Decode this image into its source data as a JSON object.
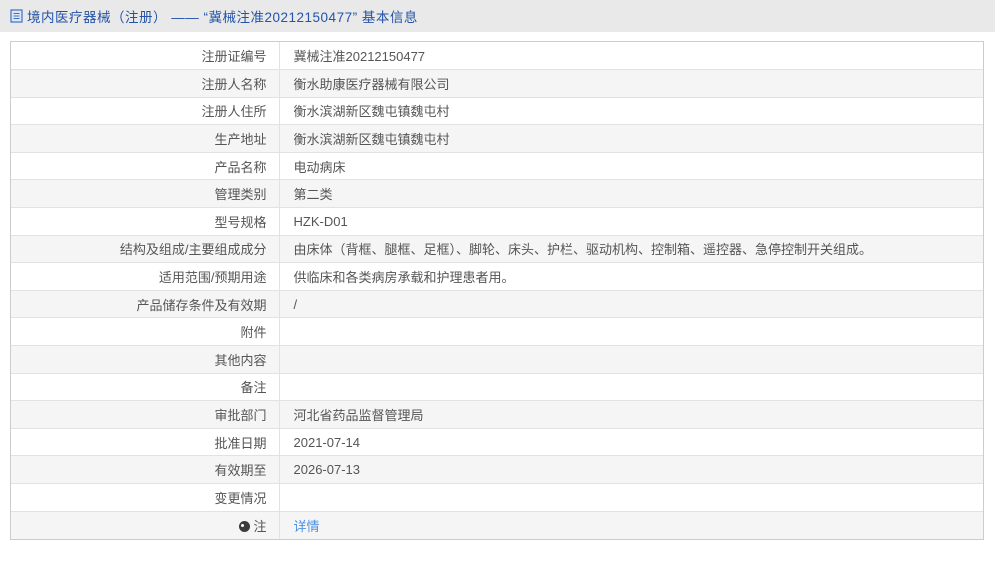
{
  "header": {
    "title": "境内医疗器械（注册） —— “冀械注准20212150477” 基本信息"
  },
  "table": {
    "rows": [
      {
        "label": "注册证编号",
        "value": "冀械注准20212150477"
      },
      {
        "label": "注册人名称",
        "value": "衡水助康医疗器械有限公司"
      },
      {
        "label": "注册人住所",
        "value": "衡水滨湖新区魏屯镇魏屯村"
      },
      {
        "label": "生产地址",
        "value": "衡水滨湖新区魏屯镇魏屯村"
      },
      {
        "label": "产品名称",
        "value": "电动病床"
      },
      {
        "label": "管理类别",
        "value": "第二类"
      },
      {
        "label": "型号规格",
        "value": "HZK-D01"
      },
      {
        "label": "结构及组成/主要组成成分",
        "value": "由床体（背框、腿框、足框）、脚轮、床头、护栏、驱动机构、控制箱、遥控器、急停控制开关组成。"
      },
      {
        "label": "适用范围/预期用途",
        "value": "供临床和各类病房承载和护理患者用。"
      },
      {
        "label": "产品储存条件及有效期",
        "value": "/"
      },
      {
        "label": "附件",
        "value": ""
      },
      {
        "label": "其他内容",
        "value": ""
      },
      {
        "label": "备注",
        "value": ""
      },
      {
        "label": "审批部门",
        "value": "河北省药品监督管理局"
      },
      {
        "label": "批准日期",
        "value": "2021-07-14"
      },
      {
        "label": "有效期至",
        "value": "2026-07-13"
      },
      {
        "label": "变更情况",
        "value": ""
      },
      {
        "label": "注",
        "value": "详情",
        "type": "link",
        "label_icon": "note-balloon-icon"
      }
    ]
  },
  "colors": {
    "header_text": "#2353a8",
    "link": "#4a90e2",
    "band_background": "#e9e9e9",
    "alt_row_background": "#f5f5f5",
    "table_border": "#cccccc",
    "cell_text": "#555555"
  }
}
